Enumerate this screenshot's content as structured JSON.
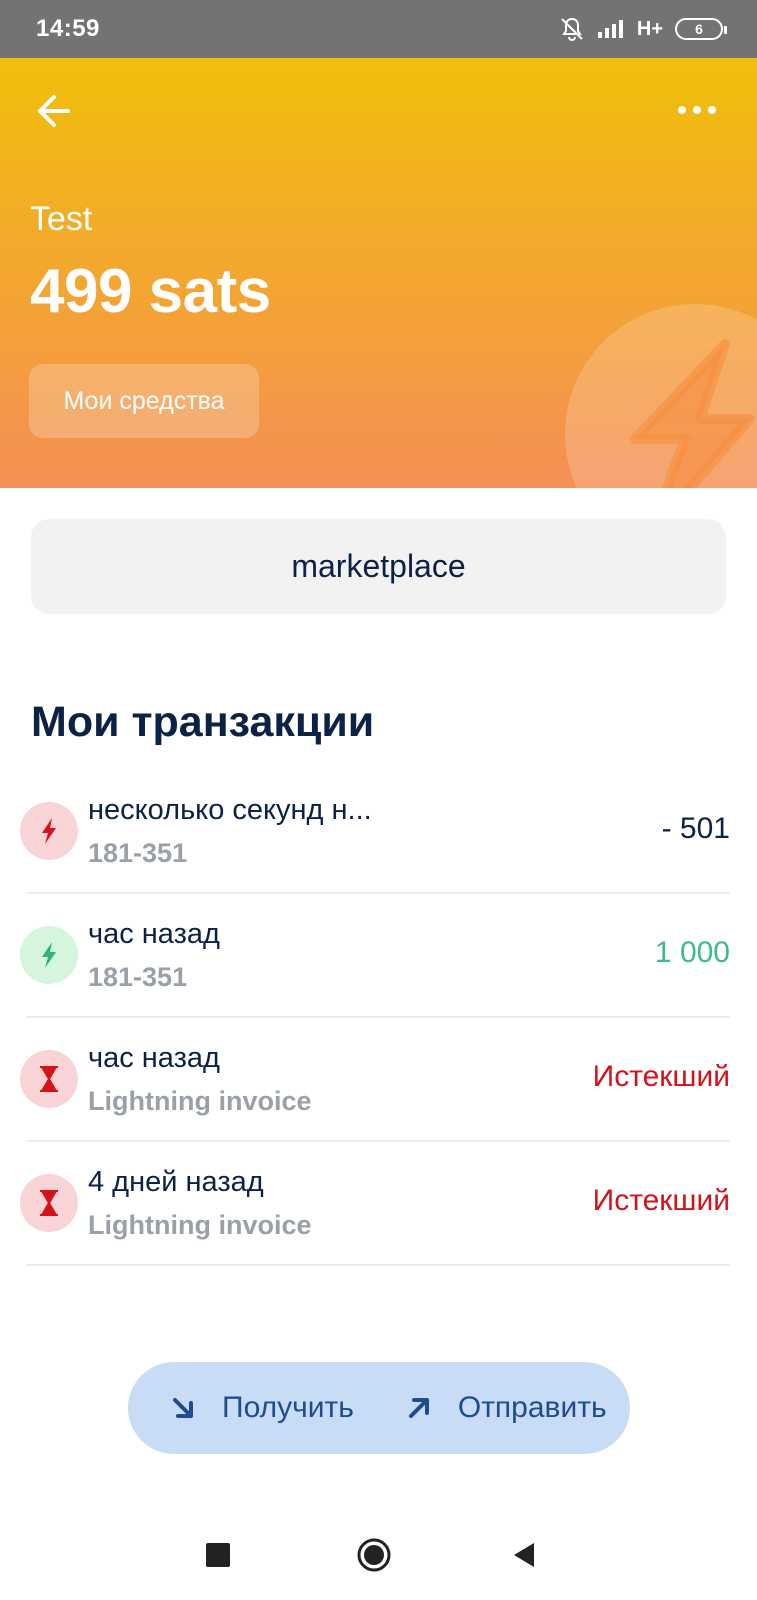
{
  "status_bar": {
    "time": "14:59",
    "network": "H+",
    "battery": "6"
  },
  "header": {
    "wallet_name": "Test",
    "balance": "499 sats",
    "funds_button": "Мои средства",
    "gradient_top": "#f0bf0b",
    "gradient_bottom": "#f58f55"
  },
  "marketplace_button": "marketplace",
  "transactions": {
    "title": "Мои транзакции",
    "items": [
      {
        "title": "несколько секунд н...",
        "subtitle": "181-351",
        "amount": "- 501",
        "icon": "lightning-icon",
        "status_color": "#0c2146"
      },
      {
        "title": "час назад",
        "subtitle": "181-351",
        "amount": "1 000",
        "icon": "lightning-icon",
        "status_color": "#3fb895"
      },
      {
        "title": "час назад",
        "subtitle": "Lightning invoice",
        "amount": "Истекший",
        "icon": "hourglass-icon",
        "status_color": "#d3121a"
      },
      {
        "title": "4 дней назад",
        "subtitle": "Lightning invoice",
        "amount": "Истекший",
        "icon": "hourglass-icon",
        "status_color": "#d3121a"
      }
    ]
  },
  "actions": {
    "receive": "Получить",
    "send": "Отправить"
  }
}
